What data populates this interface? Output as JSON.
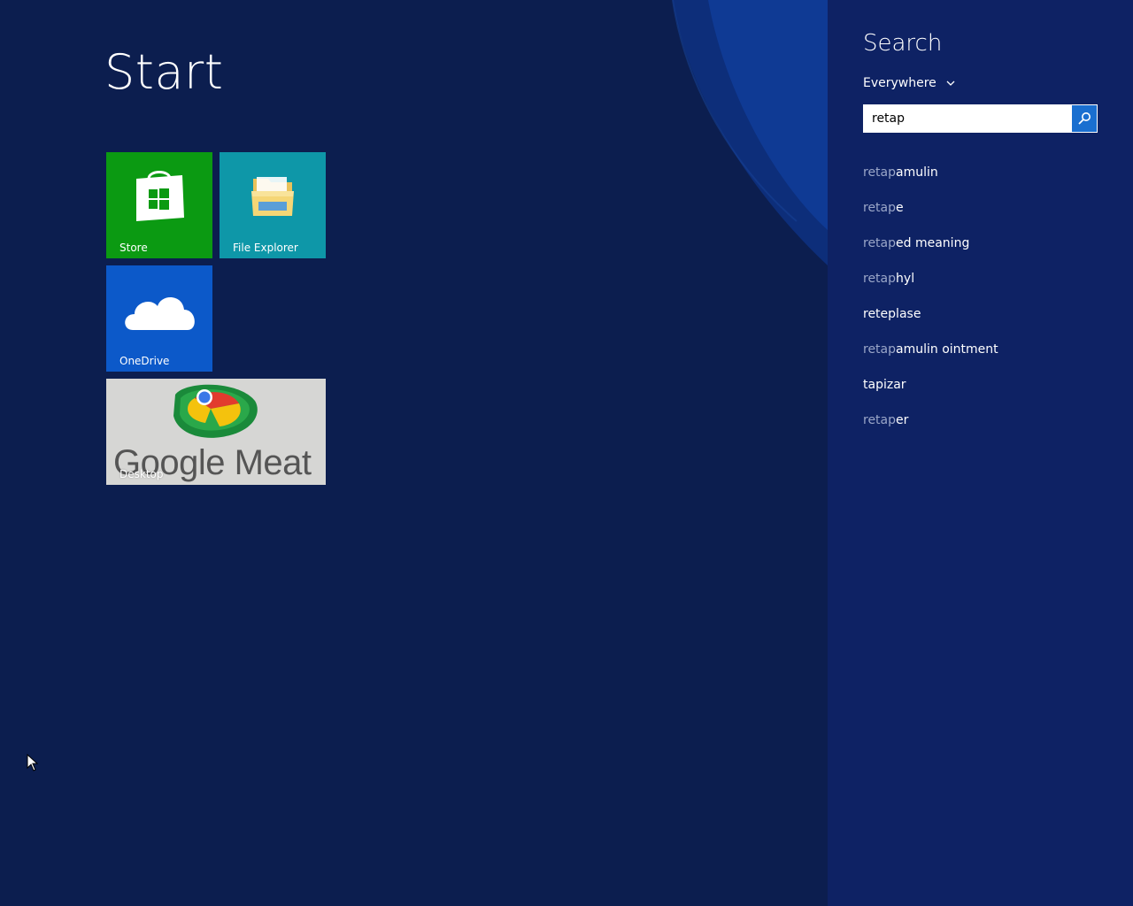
{
  "start": {
    "title": "Start"
  },
  "tiles": {
    "store": {
      "label": "Store",
      "icon": "store-bag-icon",
      "color": "#0b9a12"
    },
    "file_explorer": {
      "label": "File Explorer",
      "icon": "folder-icon",
      "color": "#0e97a8"
    },
    "onedrive": {
      "label": "OneDrive",
      "icon": "cloud-icon",
      "color": "#0c59c9"
    },
    "desktop": {
      "label": "Desktop",
      "image_text": "Google Meat",
      "icon": "google-meat-logo-icon"
    }
  },
  "search": {
    "title": "Search",
    "scope": "Everywhere",
    "query": "retap",
    "suggestions": [
      {
        "match": "retap",
        "rest": "amulin"
      },
      {
        "match": "retap",
        "rest": "e"
      },
      {
        "match": "retap",
        "rest": "ed meaning"
      },
      {
        "match": "retap",
        "rest": "hyl"
      },
      {
        "match": "",
        "rest": "reteplase"
      },
      {
        "match": "retap",
        "rest": "amulin ointment"
      },
      {
        "match": "",
        "rest": "tapizar"
      },
      {
        "match": "retap",
        "rest": "er"
      }
    ]
  },
  "colors": {
    "background": "#0c1e4f",
    "search_pane": "#0e2264",
    "accent": "#1a6fd0"
  }
}
